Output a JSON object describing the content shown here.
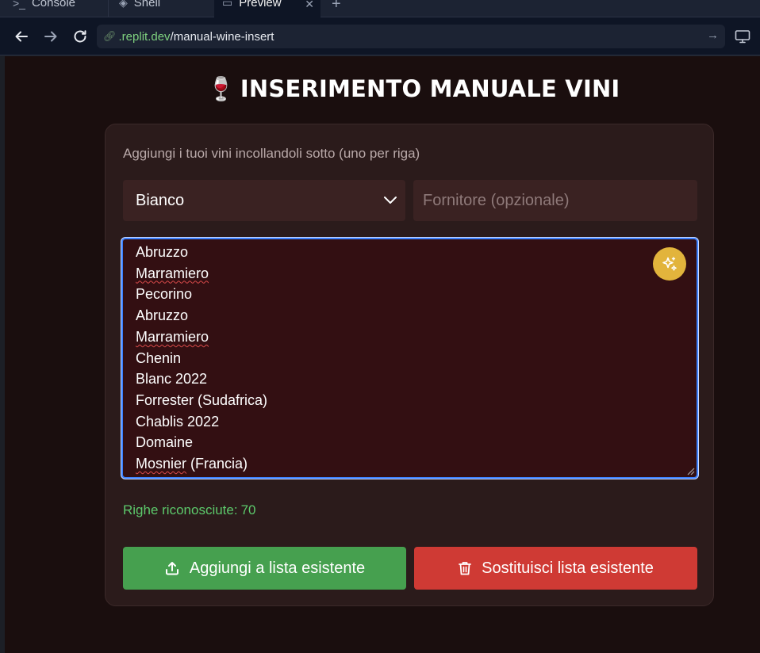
{
  "browser": {
    "tabs": [
      {
        "label": "Console",
        "icon": "terminal-icon"
      },
      {
        "label": "Shell",
        "icon": "shell-icon"
      },
      {
        "label": "Preview",
        "icon": "monitor-icon",
        "active": true
      }
    ],
    "url": {
      "domain": ".replit.dev",
      "path": "/manual-wine-insert"
    }
  },
  "page": {
    "title_emoji": "🍷",
    "title": "INSERIMENTO MANUALE VINI",
    "hint": "Aggiungi i tuoi vini incollandoli sotto (uno per riga)",
    "wine_type": {
      "selected": "Bianco"
    },
    "supplier": {
      "placeholder": "Fornitore (opzionale)",
      "value": ""
    },
    "wine_lines": [
      "Abruzzo",
      "Marramiero",
      "Pecorino",
      "Abruzzo",
      "Marramiero",
      "Chenin",
      "Blanc 2022",
      "Forrester (Sudafrica)",
      "Chablis 2022",
      "Domaine",
      "Mosnier (Francia)"
    ],
    "row_count": {
      "label": "Righe riconosciute:",
      "value": "70"
    },
    "buttons": {
      "add": "Aggiungi a lista esistente",
      "replace": "Sostituisci lista esistente"
    },
    "colors": {
      "accent_focus": "#3d82ff",
      "add_green": "#46a04f",
      "replace_red": "#cf3a34",
      "magic_gold": "#e2b43c",
      "count_green": "#5cc96b"
    }
  }
}
